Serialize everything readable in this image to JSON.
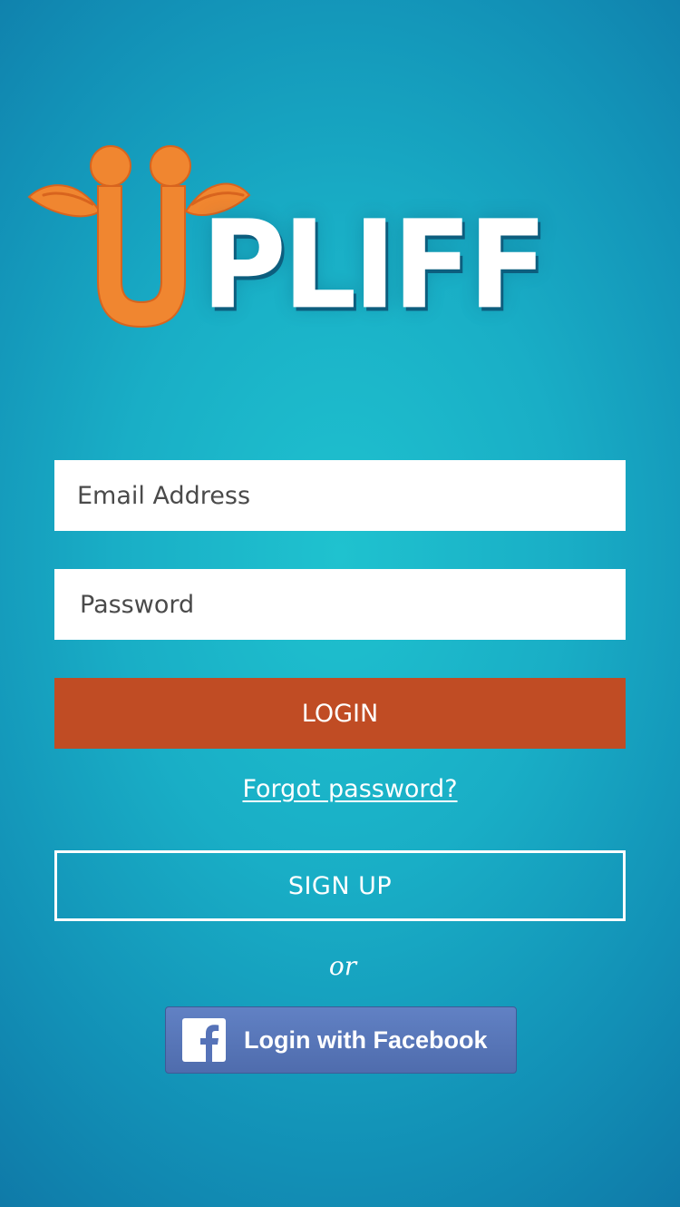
{
  "app": {
    "logo_text": "UPLIFF",
    "logo_wordmark_tail": "PLIFF"
  },
  "form": {
    "email_placeholder": "Email Address",
    "password_placeholder": "Password",
    "login_label": "LOGIN",
    "forgot_label": "Forgot password?",
    "signup_label": "SIGN UP",
    "or_label": "or"
  },
  "facebook": {
    "label": "Login with Facebook",
    "icon": "facebook-f-icon"
  },
  "colors": {
    "background": "#1fc2cf",
    "logo_orange": "#f08630",
    "login_button": "#c04c24",
    "facebook_blue": "#5673b8"
  }
}
